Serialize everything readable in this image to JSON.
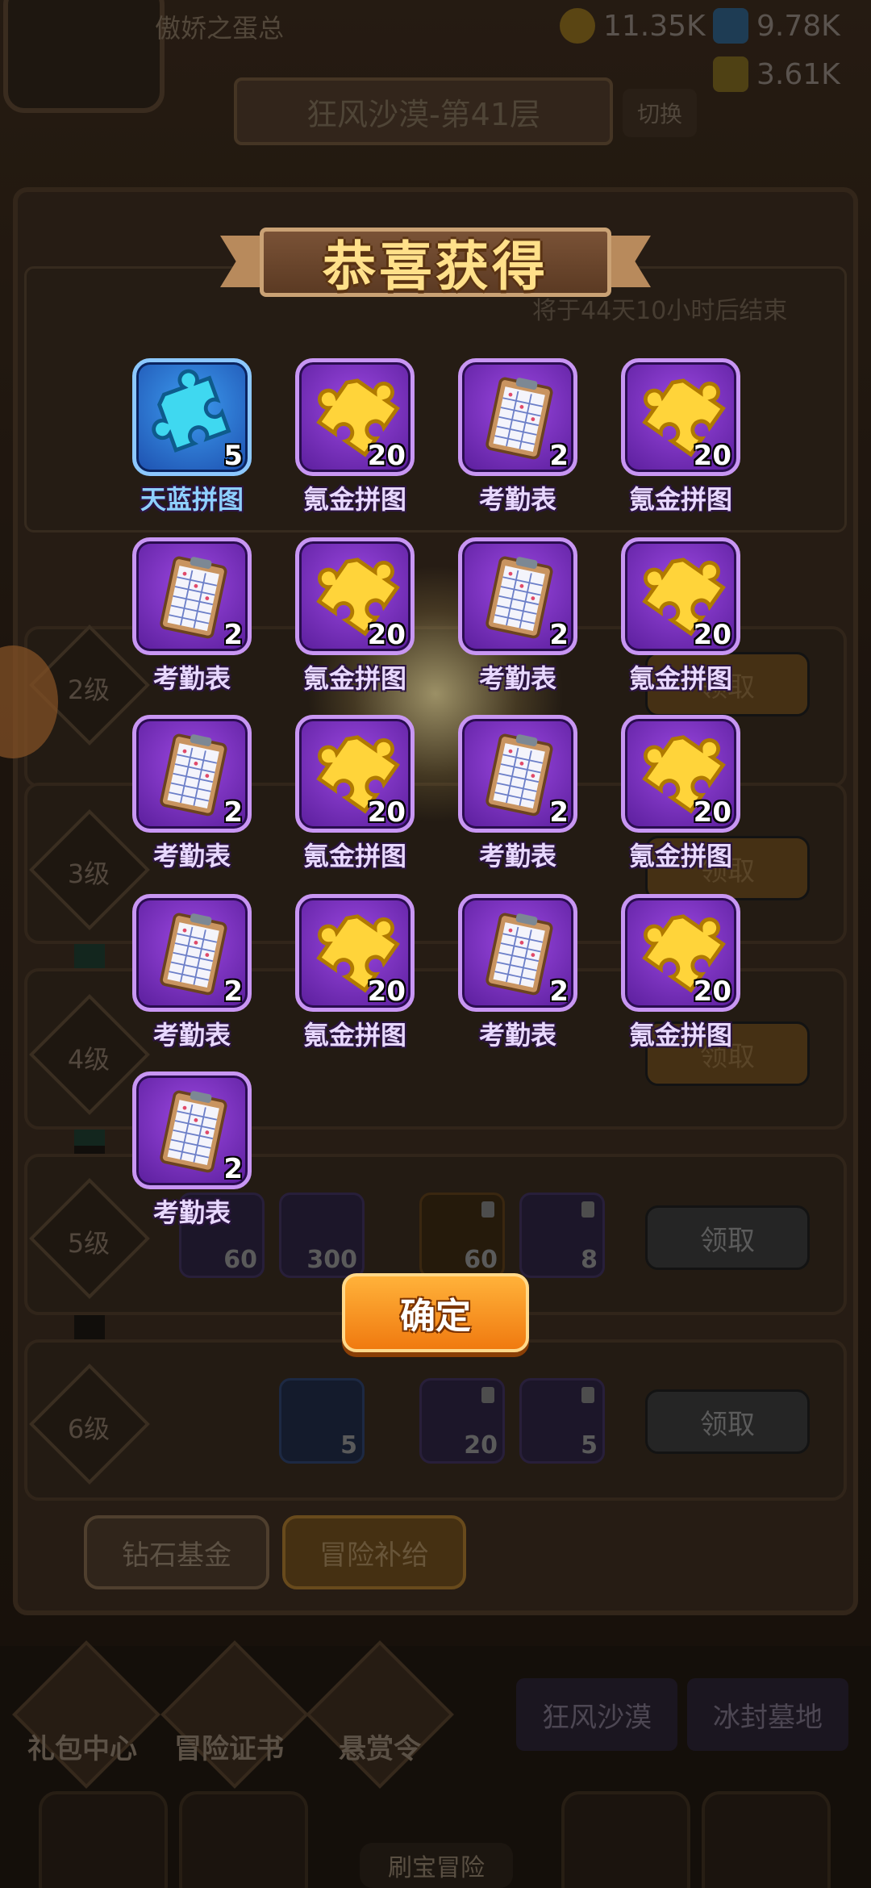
{
  "background": {
    "player_name": "傲娇之蛋总",
    "resources": [
      {
        "icon": "gold-coin-icon",
        "value": "11.35K"
      },
      {
        "icon": "blue-gem-icon",
        "value": "9.78K"
      },
      {
        "icon": "gold-ore-icon",
        "value": "3.61K"
      }
    ],
    "stage_title": "狂风沙漠-第41层",
    "switch_label": "切换",
    "panel_timer_text": "将于44天10小时后结束",
    "tiers": [
      {
        "label": "2级",
        "claim_label": "领取"
      },
      {
        "label": "3级",
        "claim_label": "领取"
      },
      {
        "label": "4级",
        "claim_label": "领取"
      },
      {
        "label": "5级",
        "claim_label": "领取",
        "items": [
          {
            "value": "60"
          },
          {
            "value": "300"
          },
          {
            "value": "60"
          },
          {
            "value": "8"
          }
        ]
      },
      {
        "label": "6级",
        "claim_label": "领取",
        "items": [
          {
            "value": "5"
          },
          {
            "value": "20"
          },
          {
            "value": "5"
          }
        ]
      }
    ],
    "tabs": [
      {
        "label": "钻石基金"
      },
      {
        "label": "冒险补给"
      }
    ],
    "nav": [
      {
        "label": "礼包中心",
        "icon": "diamond-icon"
      },
      {
        "label": "冒险证书",
        "icon": "book-icon"
      },
      {
        "label": "悬赏令",
        "icon": "compass-icon"
      }
    ],
    "map_tabs": [
      {
        "label": "狂风沙漠"
      },
      {
        "label": "冰封墓地"
      }
    ],
    "dock_center_label": "刷宝冒险"
  },
  "popup": {
    "title": "恭喜获得",
    "confirm_label": "确定",
    "rewards": [
      {
        "name": "天蓝拼图",
        "count": "5",
        "icon": "blue-puzzle-icon",
        "rarity": "blue"
      },
      {
        "name": "氪金拼图",
        "count": "20",
        "icon": "gold-puzzle-icon",
        "rarity": "purple"
      },
      {
        "name": "考勤表",
        "count": "2",
        "icon": "clipboard-icon",
        "rarity": "purple"
      },
      {
        "name": "氪金拼图",
        "count": "20",
        "icon": "gold-puzzle-icon",
        "rarity": "purple"
      },
      {
        "name": "考勤表",
        "count": "2",
        "icon": "clipboard-icon",
        "rarity": "purple"
      },
      {
        "name": "氪金拼图",
        "count": "20",
        "icon": "gold-puzzle-icon",
        "rarity": "purple"
      },
      {
        "name": "考勤表",
        "count": "2",
        "icon": "clipboard-icon",
        "rarity": "purple"
      },
      {
        "name": "氪金拼图",
        "count": "20",
        "icon": "gold-puzzle-icon",
        "rarity": "purple"
      },
      {
        "name": "考勤表",
        "count": "2",
        "icon": "clipboard-icon",
        "rarity": "purple"
      },
      {
        "name": "氪金拼图",
        "count": "20",
        "icon": "gold-puzzle-icon",
        "rarity": "purple"
      },
      {
        "name": "考勤表",
        "count": "2",
        "icon": "clipboard-icon",
        "rarity": "purple"
      },
      {
        "name": "氪金拼图",
        "count": "20",
        "icon": "gold-puzzle-icon",
        "rarity": "purple"
      },
      {
        "name": "考勤表",
        "count": "2",
        "icon": "clipboard-icon",
        "rarity": "purple"
      },
      {
        "name": "氪金拼图",
        "count": "20",
        "icon": "gold-puzzle-icon",
        "rarity": "purple"
      },
      {
        "name": "考勤表",
        "count": "2",
        "icon": "clipboard-icon",
        "rarity": "purple"
      },
      {
        "name": "氪金拼图",
        "count": "20",
        "icon": "gold-puzzle-icon",
        "rarity": "purple"
      },
      {
        "name": "考勤表",
        "count": "2",
        "icon": "clipboard-icon",
        "rarity": "purple"
      }
    ]
  }
}
